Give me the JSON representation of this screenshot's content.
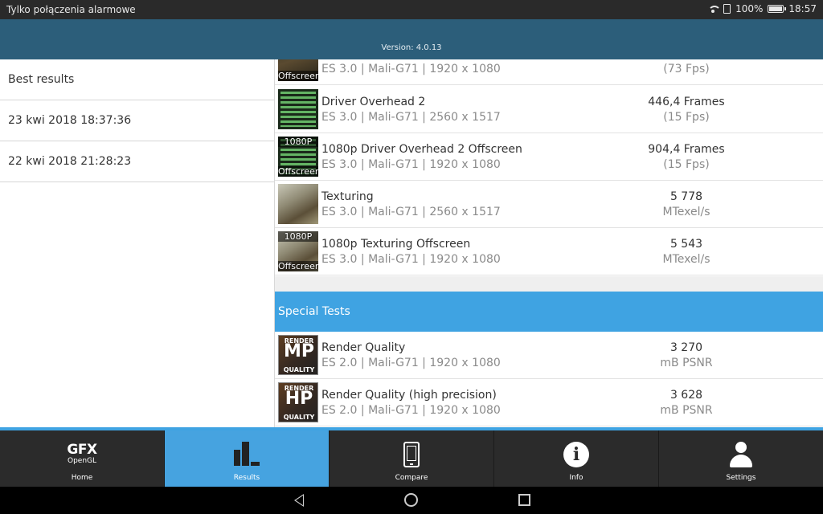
{
  "status_bar": {
    "carrier_text": "Tylko połączenia alarmowe",
    "battery_text": "100%",
    "time": "18:57"
  },
  "header": {
    "version": "Version: 4.0.13"
  },
  "left_list": [
    {
      "label": "Best results"
    },
    {
      "label": "23 kwi 2018 18:37:36"
    },
    {
      "label": "22 kwi 2018 21:28:23"
    }
  ],
  "results": [
    {
      "thumb": "offscreen",
      "thumb_label": "Offscreen",
      "name": "",
      "sub": "ES 3.0 | Mali-G71 | 1920 x 1080",
      "value": "",
      "unit": "(73 Fps)"
    },
    {
      "thumb": "overhead",
      "name": "Driver Overhead 2",
      "sub": "ES 3.0 | Mali-G71 | 2560 x 1517",
      "value": "446,4 Frames",
      "unit": "(15 Fps)"
    },
    {
      "thumb": "overhead_1080",
      "thumb_top": "1080P",
      "thumb_label": "Offscreen",
      "name": "1080p Driver Overhead 2 Offscreen",
      "sub": "ES 3.0 | Mali-G71 | 1920 x 1080",
      "value": "904,4 Frames",
      "unit": "(15 Fps)"
    },
    {
      "thumb": "texturing",
      "name": "Texturing",
      "sub": "ES 3.0 | Mali-G71 | 2560 x 1517",
      "value": "5 778",
      "unit": "MTexel/s"
    },
    {
      "thumb": "texturing_1080",
      "thumb_top": "1080P",
      "thumb_label": "Offscreen",
      "name": "1080p Texturing Offscreen",
      "sub": "ES 3.0 | Mali-G71 | 1920 x 1080",
      "value": "5 543",
      "unit": "MTexel/s"
    }
  ],
  "special_section": {
    "title": "Special Tests"
  },
  "special_results": [
    {
      "thumb_top": "RENDER",
      "thumb_big": "MP",
      "thumb_bottom": "QUALITY",
      "name": "Render Quality",
      "sub": "ES 2.0 | Mali-G71 | 1920 x 1080",
      "value": "3 270",
      "unit": "mB PSNR"
    },
    {
      "thumb_top": "RENDER",
      "thumb_big": "HP",
      "thumb_bottom": "QUALITY",
      "name": "Render Quality (high precision)",
      "sub": "ES 2.0 | Mali-G71 | 1920 x 1080",
      "value": "3 628",
      "unit": "mB PSNR"
    }
  ],
  "bottom_nav": [
    {
      "label": "Home",
      "icon": "gfx-logo-icon",
      "logo_main": "GFX",
      "logo_sub": "OpenGL"
    },
    {
      "label": "Results",
      "icon": "bar-chart-icon",
      "active": true
    },
    {
      "label": "Compare",
      "icon": "phone-icon"
    },
    {
      "label": "Info",
      "icon": "info-icon"
    },
    {
      "label": "Settings",
      "icon": "person-icon"
    }
  ],
  "colors": {
    "header": "#2c5e7a",
    "accent": "#3fa3e2",
    "nav_bg": "#2b2b2b"
  }
}
